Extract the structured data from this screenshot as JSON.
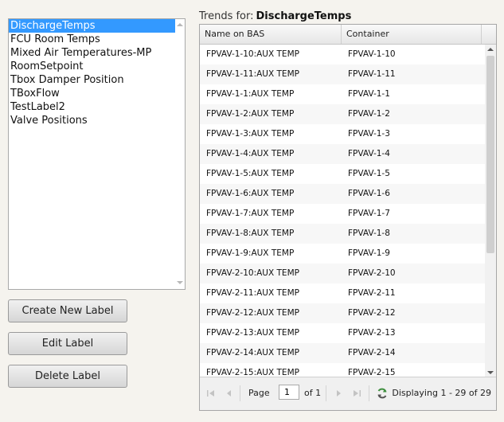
{
  "labels": {
    "items": [
      "DischargeTemps",
      "FCU Room Temps",
      "Mixed Air Temperatures-MP",
      "RoomSetpoint",
      "Tbox Damper Position",
      "TBoxFlow",
      "TestLabel2",
      "Valve Positions"
    ],
    "selected_index": 0
  },
  "buttons": {
    "create": "Create New Label",
    "edit": "Edit Label",
    "delete": "Delete Label"
  },
  "trends": {
    "prefix": "Trends for:",
    "selected_label": "DischargeTemps"
  },
  "grid": {
    "columns": [
      "Name on BAS",
      "Container"
    ],
    "rows": [
      [
        "FPVAV-1-10:AUX TEMP",
        "FPVAV-1-10"
      ],
      [
        "FPVAV-1-11:AUX TEMP",
        "FPVAV-1-11"
      ],
      [
        "FPVAV-1-1:AUX TEMP",
        "FPVAV-1-1"
      ],
      [
        "FPVAV-1-2:AUX TEMP",
        "FPVAV-1-2"
      ],
      [
        "FPVAV-1-3:AUX TEMP",
        "FPVAV-1-3"
      ],
      [
        "FPVAV-1-4:AUX TEMP",
        "FPVAV-1-4"
      ],
      [
        "FPVAV-1-5:AUX TEMP",
        "FPVAV-1-5"
      ],
      [
        "FPVAV-1-6:AUX TEMP",
        "FPVAV-1-6"
      ],
      [
        "FPVAV-1-7:AUX TEMP",
        "FPVAV-1-7"
      ],
      [
        "FPVAV-1-8:AUX TEMP",
        "FPVAV-1-8"
      ],
      [
        "FPVAV-1-9:AUX TEMP",
        "FPVAV-1-9"
      ],
      [
        "FPVAV-2-10:AUX TEMP",
        "FPVAV-2-10"
      ],
      [
        "FPVAV-2-11:AUX TEMP",
        "FPVAV-2-11"
      ],
      [
        "FPVAV-2-12:AUX TEMP",
        "FPVAV-2-12"
      ],
      [
        "FPVAV-2-13:AUX TEMP",
        "FPVAV-2-13"
      ],
      [
        "FPVAV-2-14:AUX TEMP",
        "FPVAV-2-14"
      ],
      [
        "FPVAV-2-15:AUX TEMP",
        "FPVAV-2-15"
      ]
    ]
  },
  "pager": {
    "page_label": "Page",
    "page_value": "1",
    "of_label": "of 1",
    "displaying": "Displaying 1 - 29 of 29"
  },
  "icons": {
    "first": "first-page-icon",
    "prev": "prev-page-icon",
    "next": "next-page-icon",
    "last": "last-page-icon",
    "refresh": "refresh-icon"
  },
  "colors": {
    "selection": "#3399ff",
    "background": "#f5f3ee"
  }
}
